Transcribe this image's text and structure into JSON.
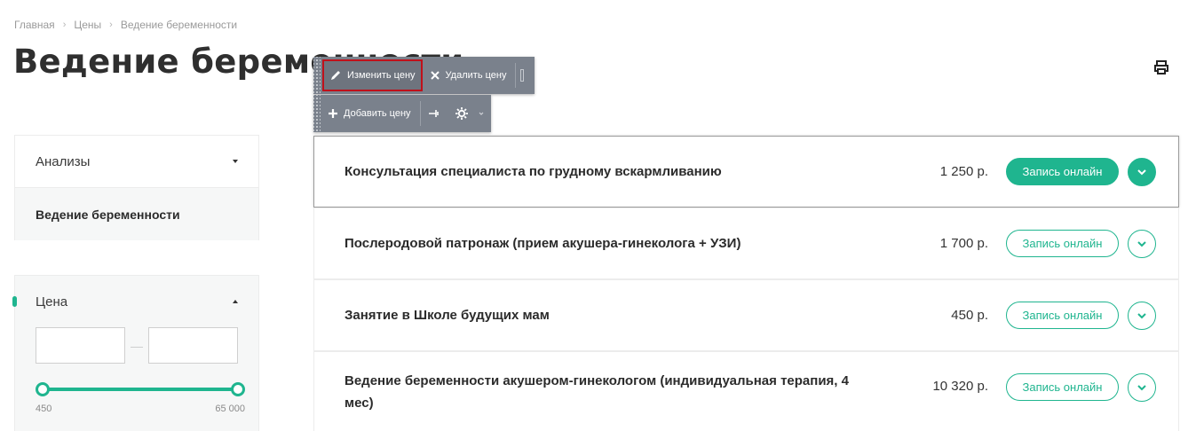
{
  "breadcrumb": {
    "home": "Главная",
    "prices": "Цены",
    "current": "Ведение беременности",
    "separator": "›"
  },
  "page": {
    "title": "Ведение беременности"
  },
  "toolbar": {
    "edit_price": "Изменить цену",
    "delete_price": "Удалить цену",
    "add_price": "Добавить цену"
  },
  "sidebar": {
    "sections": [
      {
        "label": "Анализы"
      },
      {
        "label": "Ведение беременности"
      }
    ],
    "price_filter": {
      "label": "Цена",
      "from_value": "",
      "to_value": "",
      "separator": "—",
      "min_label": "450",
      "max_label": "65 000",
      "min": 450,
      "max": 65000
    }
  },
  "services": [
    {
      "name": "Консультация специалиста по грудному вскармливанию",
      "price": "1 250 р.",
      "button": "Запись онлайн"
    },
    {
      "name": "Послеродовой патронаж (прием акушера-гинеколога + УЗИ)",
      "price": "1 700 р.",
      "button": "Запись онлайн"
    },
    {
      "name": "Занятие в Школе будущих мам",
      "price": "450 р.",
      "button": "Запись онлайн"
    },
    {
      "name": "Ведение беременности акушером-гинекологом (индивидуальная терапия, 4 мес)",
      "price": "10 320 р.",
      "button": "Запись онлайн"
    }
  ],
  "colors": {
    "accent": "#1fb58f",
    "toolbar_bg": "#7a818c",
    "active_outline": "#c0101a"
  }
}
